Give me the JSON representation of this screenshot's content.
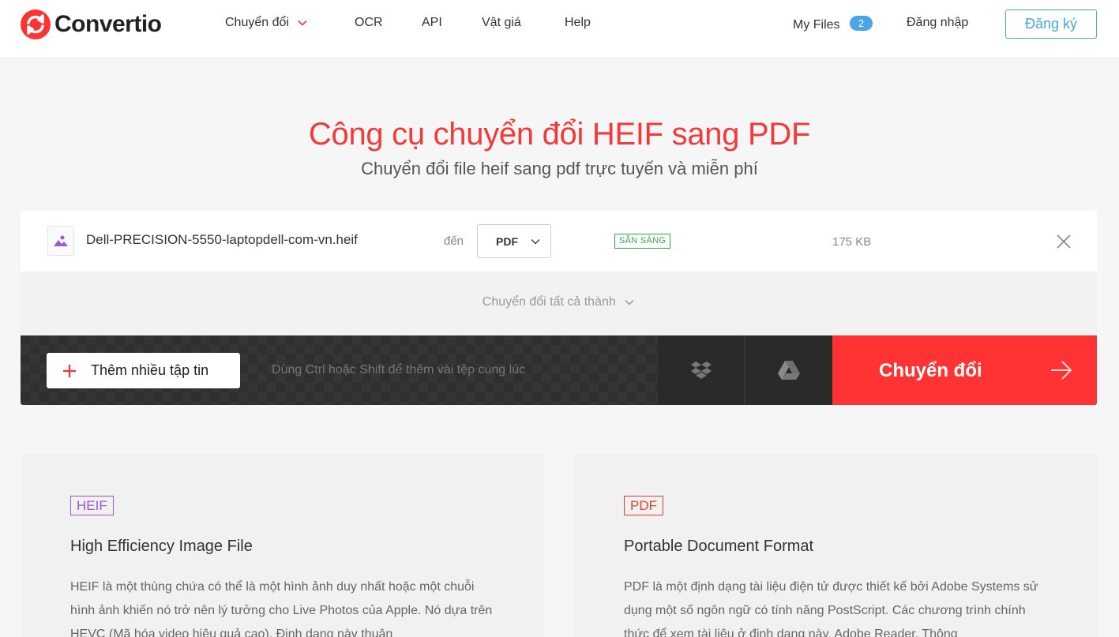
{
  "header": {
    "logo_text": "Convertio",
    "nav": [
      {
        "label": "Chuyển đổi"
      },
      {
        "label": "OCR"
      },
      {
        "label": "API"
      },
      {
        "label": "Vật giá"
      },
      {
        "label": "Help"
      }
    ],
    "my_files_label": "My Files",
    "my_files_count": "2",
    "login_label": "Đăng nhập",
    "signup_label": "Đăng ký"
  },
  "hero": {
    "title": "Công cụ chuyển đổi HEIF sang PDF",
    "subtitle": "Chuyển đổi file heif sang pdf trực tuyến và miễn phí"
  },
  "file": {
    "name": "Dell-PRECISION-5550-laptopdell-com-vn.heif",
    "to_label": "đến",
    "format": "PDF",
    "status": "SẴN SÀNG",
    "size": "175 KB"
  },
  "convert_all_label": "Chuyển đổi tất cả thành",
  "actions": {
    "add_files_label": "Thêm nhiều tập tin",
    "hint": "Dùng Ctrl hoặc Shift để thêm vài tệp cùng lúc",
    "convert_label": "Chuyển đổi"
  },
  "cards": [
    {
      "tag": "HEIF",
      "title": "High Efficiency Image File",
      "desc": "HEIF là một thùng chứa có thể là một hình ảnh duy nhất hoặc một chuỗi hình ảnh khiến nó trở nên lý tưởng cho Live Photos của Apple. Nó dựa trên HEVC (Mã hóa video hiệu quả cao). Định dạng này thuận"
    },
    {
      "tag": "PDF",
      "title": "Portable Document Format",
      "desc": "PDF là một định dạng tài liệu điện tử được thiết kế bởi Adobe Systems sử dụng một số ngôn ngữ có tính năng PostScript. Các chương trình chính thức để xem tài liệu ở định dạng này, Adobe Reader. Thông"
    }
  ],
  "colors": {
    "brand_red": "#ff3333",
    "accent_blue": "#4aa4e6",
    "status_green": "#36a94f",
    "heif_purple": "#9b59d0",
    "pdf_red": "#ea4335"
  },
  "icons": {
    "logo": "convertio-logo-icon",
    "file": "image-file-icon",
    "dropdown": "chevron-down-icon",
    "close": "close-icon",
    "add": "plus-icon",
    "dropbox": "dropbox-icon",
    "gdrive": "google-drive-icon",
    "convert": "arrow-right-icon"
  }
}
